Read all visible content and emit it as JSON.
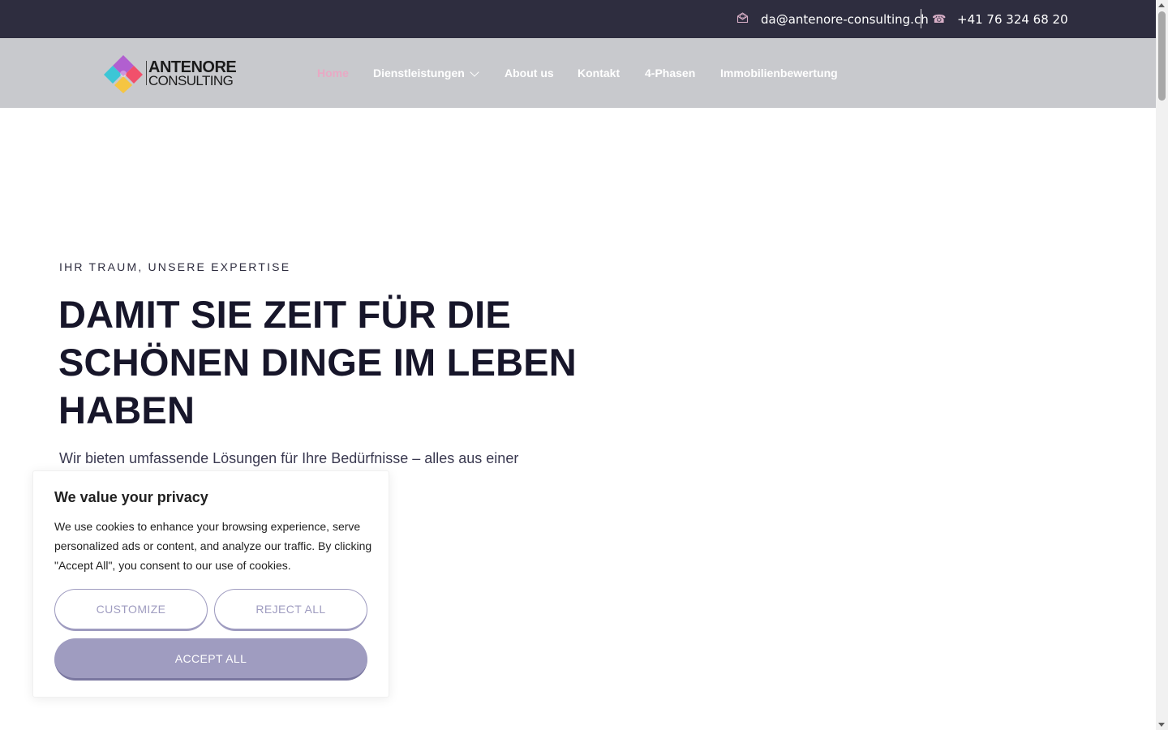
{
  "topbar": {
    "email": "da@antenore-consulting.ch",
    "email_icon": "mail-open-icon",
    "phone": "+41 76 324 68 20",
    "phone_icon": "phone-icon",
    "background": "#2e2d3f"
  },
  "logo": {
    "line1": "ANTENORE",
    "line2": "CONSULTING"
  },
  "nav": {
    "items": [
      {
        "label": "Home",
        "active": true
      },
      {
        "label": "Dienstleistungen",
        "has_dropdown": true
      },
      {
        "label": "About us"
      },
      {
        "label": "Kontakt"
      },
      {
        "label": "4-Phasen"
      },
      {
        "label": "Immobilienbewertung"
      }
    ],
    "active_color": "#e8a9c4",
    "background": "#c8c9cd"
  },
  "hero": {
    "eyebrow": "IHR TRAUM, UNSERE EXPERTISE",
    "headline": "DAMIT SIE ZEIT FÜR DIE SCHÖNEN DINGE IM LEBEN HABEN",
    "lead": "Wir bieten umfassende Lösungen für Ihre Bedürfnisse – alles aus einer"
  },
  "cookie": {
    "title": "We value your privacy",
    "text": "We use cookies to enhance your browsing experience, serve personalized ads or content, and analyze our traffic. By clicking \"Accept All\", you consent to our use of cookies.",
    "customize_label": "CUSTOMIZE",
    "reject_label": "REJECT ALL",
    "accept_label": "ACCEPT ALL",
    "accent": "#9f9cc0"
  }
}
